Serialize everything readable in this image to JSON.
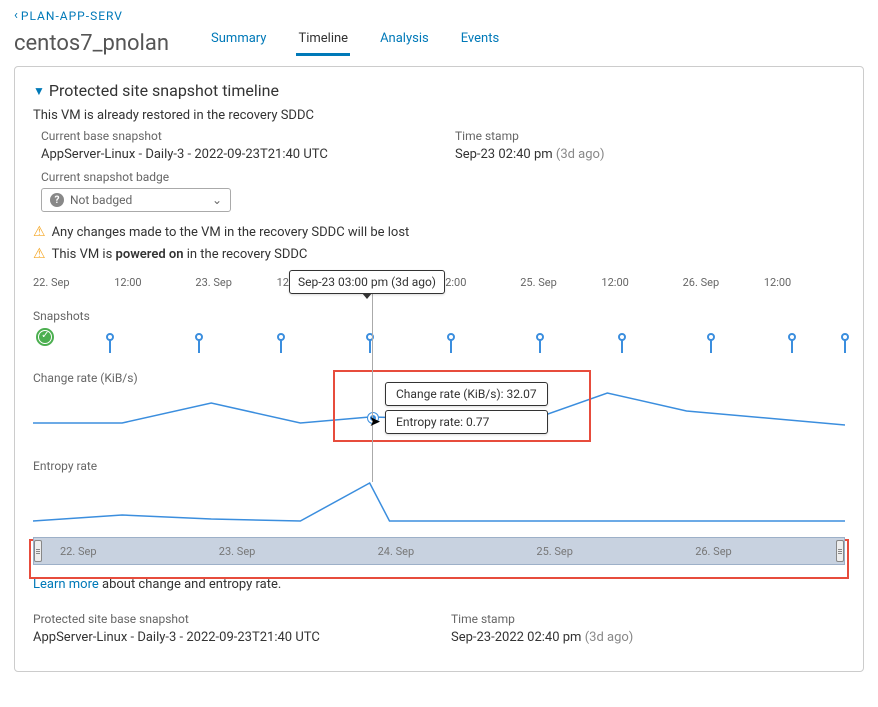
{
  "breadcrumb": {
    "parent": "PLAN",
    "sep": " - ",
    "name": "APP-SERV"
  },
  "page_title": "centos7_pnolan",
  "tabs": [
    {
      "id": "summary",
      "label": "Summary"
    },
    {
      "id": "timeline",
      "label": "Timeline"
    },
    {
      "id": "analysis",
      "label": "Analysis"
    },
    {
      "id": "events",
      "label": "Events"
    }
  ],
  "active_tab": "timeline",
  "section_title": "Protected site snapshot timeline",
  "restored_msg": "This VM is already restored in the recovery SDDC",
  "labels": {
    "current_base": "Current base snapshot",
    "timestamp": "Time stamp",
    "badge": "Current snapshot badge",
    "snapshots": "Snapshots",
    "change_rate": "Change rate (KiB/s)",
    "entropy_rate": "Entropy rate",
    "protected_base": "Protected site base snapshot"
  },
  "snapshot": {
    "name": "AppServer-Linux - Daily-3 - 2022-09-23T21:40 UTC",
    "ts": "Sep-23 02:40 pm",
    "ago": "(3d ago)"
  },
  "badge_select": {
    "value": "Not badged"
  },
  "warning1": "Any changes made to the VM in the recovery SDDC will be lost",
  "warning2_pre": "This VM is ",
  "warning2_bold": "powered on",
  "warning2_post": " in the recovery SDDC",
  "hover_tooltip": "Sep-23 03:00 pm (3d ago)",
  "axis_ticks": [
    "22. Sep",
    "12:00",
    "23. Sep",
    "12:00",
    "24. Sep",
    "12:00",
    "25. Sep",
    "12:00",
    "26. Sep",
    "12:00"
  ],
  "popup": {
    "change": "Change rate (KiB/s): 32.07",
    "entropy": "Entropy rate: 0.77"
  },
  "chart_data": [
    {
      "type": "line",
      "title": "Change rate (KiB/s)",
      "x_ticks": [
        "22. Sep",
        "12:00",
        "23. Sep",
        "12:00",
        "24. Sep",
        "12:00",
        "25. Sep",
        "12:00",
        "26. Sep",
        "12:00"
      ],
      "ylabel": "KiB/s",
      "ylim": [
        0,
        100
      ],
      "hover": {
        "x_label": "Sep-23 03:00 pm (3d ago)",
        "value": 32.07
      },
      "values_est": [
        25,
        25,
        45,
        25,
        32,
        30,
        28,
        90,
        50,
        30
      ]
    },
    {
      "type": "line",
      "title": "Entropy rate",
      "x_ticks": [
        "22. Sep",
        "12:00",
        "23. Sep",
        "12:00",
        "24. Sep",
        "12:00",
        "25. Sep",
        "12:00",
        "26. Sep",
        "12:00"
      ],
      "ylabel": "",
      "ylim": [
        0,
        1
      ],
      "hover": {
        "x_label": "Sep-23 03:00 pm (3d ago)",
        "value": 0.77
      },
      "values_est": [
        0.1,
        0.18,
        0.12,
        0.1,
        0.77,
        0.1,
        0.1,
        0.1,
        0.1,
        0.1
      ]
    }
  ],
  "brush_ticks": [
    "22. Sep",
    "23. Sep",
    "24. Sep",
    "25. Sep",
    "26. Sep"
  ],
  "learn_link": "Learn more",
  "learn_text": " about change and entropy rate.",
  "protected_snapshot": {
    "name": "AppServer-Linux - Daily-3 - 2022-09-23T21:40 UTC",
    "ts": "Sep-23-2022 02:40 pm",
    "ago": "(3d ago)"
  },
  "snapshot_pins_pct": [
    1,
    9,
    20,
    30,
    41,
    51,
    62,
    72,
    83,
    93,
    99.5
  ],
  "snapshot_pins_ok": 0
}
